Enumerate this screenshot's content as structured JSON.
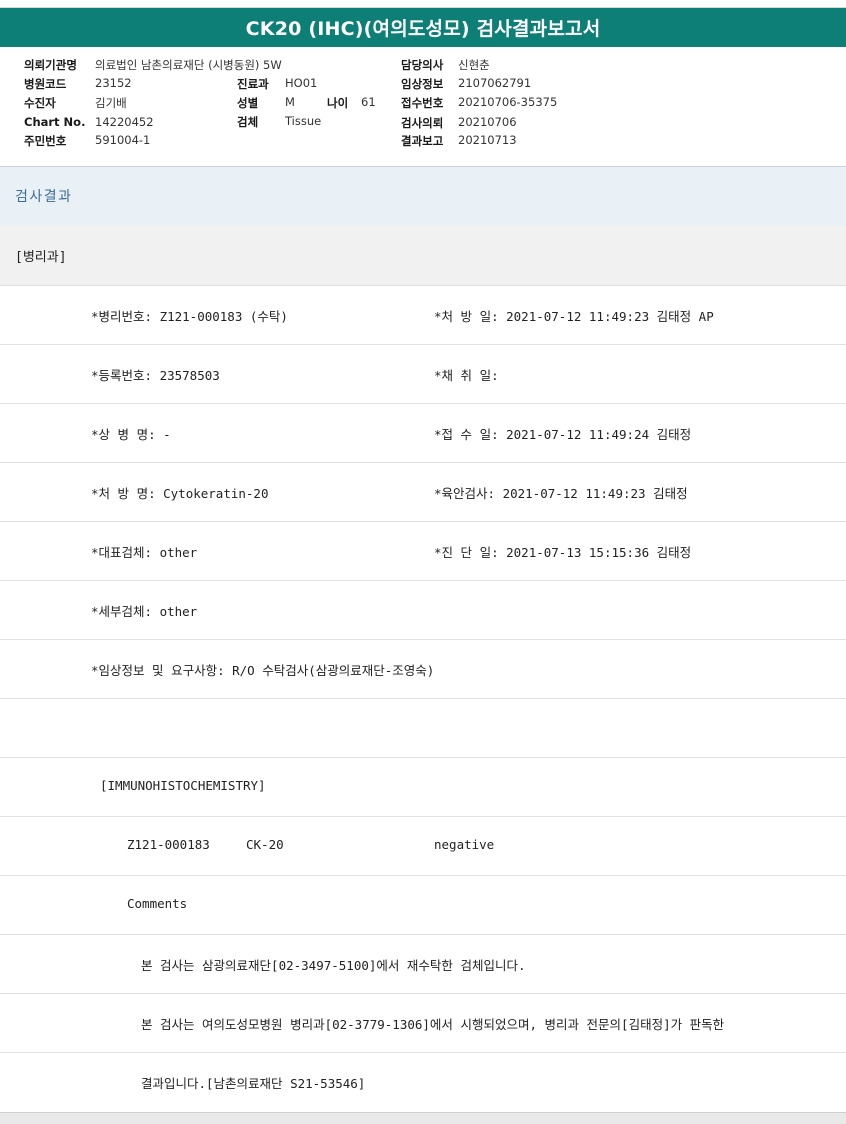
{
  "header": {
    "title": "CK20 (IHC)(여의도성모) 검사결과보고서"
  },
  "info": {
    "institution_label": "의뢰기관명",
    "institution_value": "의료법인 남촌의료재단 (시병동원) 5W",
    "attending_label": "담당의사",
    "attending_value": "신현춘",
    "hospital_code_label": "병원코드",
    "hospital_code_value": "23152",
    "dept_label": "진료과",
    "dept_value": "HO01",
    "clinical_label": "임상정보",
    "clinical_value": "2107062791",
    "patient_label": "수진자",
    "patient_value": "김기배",
    "sex_label": "성별",
    "sex_value": "M",
    "age_label": "나이",
    "age_value": "61",
    "receipt_no_label": "접수번호",
    "receipt_no_value": "20210706-35375",
    "chart_label": "Chart No.",
    "chart_value": "14220452",
    "specimen_label": "검체",
    "specimen_value": "Tissue",
    "request_label": "검사의뢰",
    "request_value": "20210706",
    "id_label": "주민번호",
    "id_value": "591004-1",
    "report_label": "결과보고",
    "report_value": "20210713"
  },
  "section": {
    "title": "검사결과"
  },
  "department": "[병리과]",
  "rows": {
    "path_no": "*병리번호: Z121-000183 (수탁)",
    "prescribed_date": "*처 방 일: 2021-07-12 11:49:23  김태정 AP",
    "reg_no": "*등록번호: 23578503",
    "collected_date": "*채 취 일:",
    "disease_name": "*상 병 명: -",
    "received_date": "*접 수 일: 2021-07-12 11:49:24  김태정",
    "order_name": "*처 방 명: Cytokeratin-20",
    "gross_exam": "*육안검사: 2021-07-12 11:49:23  김태정",
    "main_specimen": "*대표검체: other",
    "diagnosis_date": "*진 단 일: 2021-07-13 15:15:36  김태정",
    "sub_specimen": "*세부검체: other",
    "clinical_info": "*임상정보 및 요구사항: R/O 수탁검사(삼광의료재단-조영숙)",
    "ihc_header": "[IMMUNOHISTOCHEMISTRY]",
    "ihc_case": "Z121-000183",
    "ihc_marker": "CK-20",
    "ihc_result": "negative",
    "comments_label": "Comments",
    "comment_1": "본 검사는 삼광의료재단[02-3497-5100]에서 재수탁한 검체입니다.",
    "comment_2": "본 검사는 여의도성모병원 병리과[02-3779-1306]에서 시행되었으며, 병리과 전문의[김태정]가 판독한",
    "comment_3": "결과입니다.[남촌의료재단 S21-53546]"
  },
  "colors": {
    "title_bg": "#0e7f77",
    "section_bg": "#eaf1f6",
    "section_text": "#3a6d96",
    "dept_bg": "#f1f1f1"
  }
}
